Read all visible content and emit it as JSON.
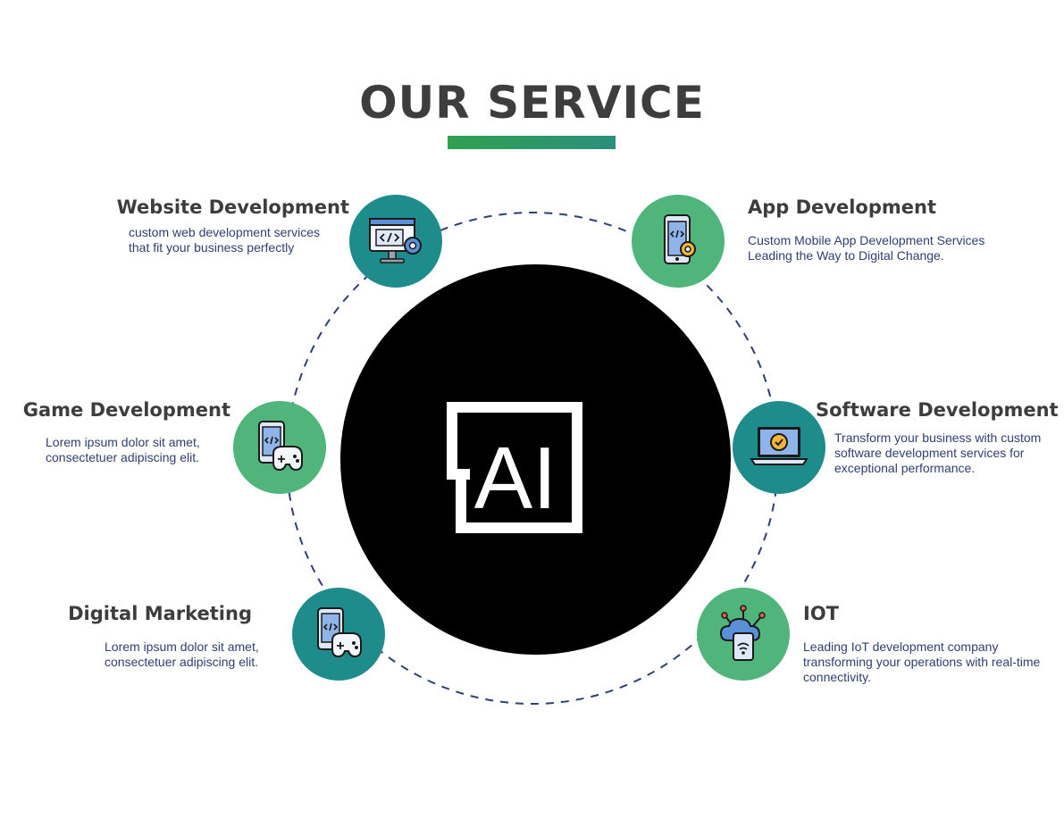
{
  "title": "OUR SERVICE",
  "center": {
    "logo_text": "AI",
    "logo_icon": "ai-logo"
  },
  "colors": {
    "teal": "#1e8c8a",
    "green": "#4fb57a",
    "heading": "#3d3d3d",
    "body_text": "#2e3f73",
    "ring": "#2e3f73"
  },
  "services": [
    {
      "title": "Website Development",
      "desc1": "custom web development services",
      "desc2": "that fit your business perfectly",
      "icon": "web-development-icon"
    },
    {
      "title": "App Development",
      "desc1": "Custom Mobile App Development Services",
      "desc2": "Leading the Way to Digital Change.",
      "icon": "mobile-app-icon"
    },
    {
      "title": "Game Development",
      "desc1": "Lorem ipsum dolor sit amet,",
      "desc2": "consectetuer adipiscing elit.",
      "icon": "game-controller-icon"
    },
    {
      "title": "Software Development",
      "desc1": "Transform your business with custom",
      "desc2": "software development services for",
      "desc3": "exceptional performance.",
      "icon": "laptop-gear-icon"
    },
    {
      "title": "Digital Marketing",
      "desc1": "Lorem ipsum dolor sit amet,",
      "desc2": "consectetuer adipiscing elit.",
      "icon": "game-controller-icon"
    },
    {
      "title": "IOT",
      "desc1": "Leading IoT development company",
      "desc2": "transforming your operations with real-time",
      "desc3": "connectivity.",
      "icon": "iot-cloud-icon"
    }
  ]
}
